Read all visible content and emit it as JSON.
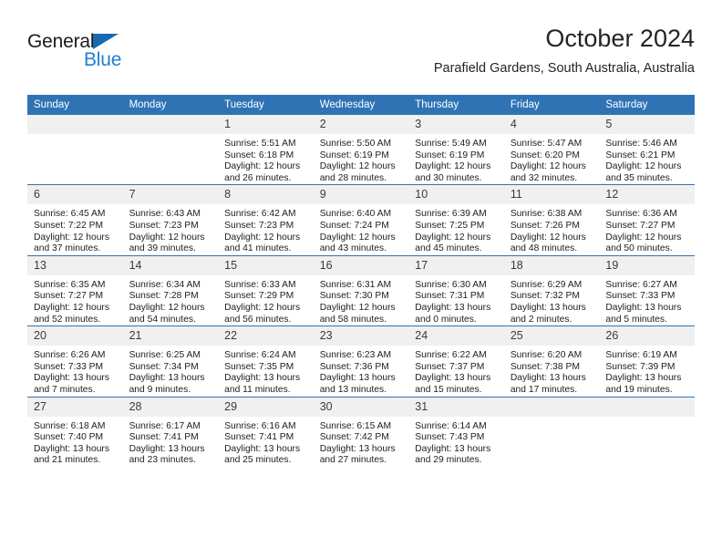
{
  "branding": {
    "logo_primary": "General",
    "logo_secondary": "Blue",
    "logo_primary_color": "#1b1b1b",
    "logo_secondary_color": "#1f7fd0",
    "triangle_icon": "blue-triangle-icon"
  },
  "header": {
    "title": "October 2024",
    "subtitle": "Parafield Gardens, South Australia, Australia"
  },
  "theme": {
    "header_blue": "#2f73b5",
    "daynum_band": "#f0f0f0",
    "text": "#1d1d1d"
  },
  "calendar": {
    "weekday_headers": [
      "Sunday",
      "Monday",
      "Tuesday",
      "Wednesday",
      "Thursday",
      "Friday",
      "Saturday"
    ],
    "weeks": [
      [
        {
          "day": "",
          "empty": true,
          "sunrise": "",
          "sunset": "",
          "daylight_line1": "",
          "daylight_line2": ""
        },
        {
          "day": "",
          "empty": true,
          "sunrise": "",
          "sunset": "",
          "daylight_line1": "",
          "daylight_line2": ""
        },
        {
          "day": "1",
          "sunrise": "Sunrise: 5:51 AM",
          "sunset": "Sunset: 6:18 PM",
          "daylight_line1": "Daylight: 12 hours",
          "daylight_line2": "and 26 minutes."
        },
        {
          "day": "2",
          "sunrise": "Sunrise: 5:50 AM",
          "sunset": "Sunset: 6:19 PM",
          "daylight_line1": "Daylight: 12 hours",
          "daylight_line2": "and 28 minutes."
        },
        {
          "day": "3",
          "sunrise": "Sunrise: 5:49 AM",
          "sunset": "Sunset: 6:19 PM",
          "daylight_line1": "Daylight: 12 hours",
          "daylight_line2": "and 30 minutes."
        },
        {
          "day": "4",
          "sunrise": "Sunrise: 5:47 AM",
          "sunset": "Sunset: 6:20 PM",
          "daylight_line1": "Daylight: 12 hours",
          "daylight_line2": "and 32 minutes."
        },
        {
          "day": "5",
          "sunrise": "Sunrise: 5:46 AM",
          "sunset": "Sunset: 6:21 PM",
          "daylight_line1": "Daylight: 12 hours",
          "daylight_line2": "and 35 minutes."
        }
      ],
      [
        {
          "day": "6",
          "sunrise": "Sunrise: 6:45 AM",
          "sunset": "Sunset: 7:22 PM",
          "daylight_line1": "Daylight: 12 hours",
          "daylight_line2": "and 37 minutes."
        },
        {
          "day": "7",
          "sunrise": "Sunrise: 6:43 AM",
          "sunset": "Sunset: 7:23 PM",
          "daylight_line1": "Daylight: 12 hours",
          "daylight_line2": "and 39 minutes."
        },
        {
          "day": "8",
          "sunrise": "Sunrise: 6:42 AM",
          "sunset": "Sunset: 7:23 PM",
          "daylight_line1": "Daylight: 12 hours",
          "daylight_line2": "and 41 minutes."
        },
        {
          "day": "9",
          "sunrise": "Sunrise: 6:40 AM",
          "sunset": "Sunset: 7:24 PM",
          "daylight_line1": "Daylight: 12 hours",
          "daylight_line2": "and 43 minutes."
        },
        {
          "day": "10",
          "sunrise": "Sunrise: 6:39 AM",
          "sunset": "Sunset: 7:25 PM",
          "daylight_line1": "Daylight: 12 hours",
          "daylight_line2": "and 45 minutes."
        },
        {
          "day": "11",
          "sunrise": "Sunrise: 6:38 AM",
          "sunset": "Sunset: 7:26 PM",
          "daylight_line1": "Daylight: 12 hours",
          "daylight_line2": "and 48 minutes."
        },
        {
          "day": "12",
          "sunrise": "Sunrise: 6:36 AM",
          "sunset": "Sunset: 7:27 PM",
          "daylight_line1": "Daylight: 12 hours",
          "daylight_line2": "and 50 minutes."
        }
      ],
      [
        {
          "day": "13",
          "sunrise": "Sunrise: 6:35 AM",
          "sunset": "Sunset: 7:27 PM",
          "daylight_line1": "Daylight: 12 hours",
          "daylight_line2": "and 52 minutes."
        },
        {
          "day": "14",
          "sunrise": "Sunrise: 6:34 AM",
          "sunset": "Sunset: 7:28 PM",
          "daylight_line1": "Daylight: 12 hours",
          "daylight_line2": "and 54 minutes."
        },
        {
          "day": "15",
          "sunrise": "Sunrise: 6:33 AM",
          "sunset": "Sunset: 7:29 PM",
          "daylight_line1": "Daylight: 12 hours",
          "daylight_line2": "and 56 minutes."
        },
        {
          "day": "16",
          "sunrise": "Sunrise: 6:31 AM",
          "sunset": "Sunset: 7:30 PM",
          "daylight_line1": "Daylight: 12 hours",
          "daylight_line2": "and 58 minutes."
        },
        {
          "day": "17",
          "sunrise": "Sunrise: 6:30 AM",
          "sunset": "Sunset: 7:31 PM",
          "daylight_line1": "Daylight: 13 hours",
          "daylight_line2": "and 0 minutes."
        },
        {
          "day": "18",
          "sunrise": "Sunrise: 6:29 AM",
          "sunset": "Sunset: 7:32 PM",
          "daylight_line1": "Daylight: 13 hours",
          "daylight_line2": "and 2 minutes."
        },
        {
          "day": "19",
          "sunrise": "Sunrise: 6:27 AM",
          "sunset": "Sunset: 7:33 PM",
          "daylight_line1": "Daylight: 13 hours",
          "daylight_line2": "and 5 minutes."
        }
      ],
      [
        {
          "day": "20",
          "sunrise": "Sunrise: 6:26 AM",
          "sunset": "Sunset: 7:33 PM",
          "daylight_line1": "Daylight: 13 hours",
          "daylight_line2": "and 7 minutes."
        },
        {
          "day": "21",
          "sunrise": "Sunrise: 6:25 AM",
          "sunset": "Sunset: 7:34 PM",
          "daylight_line1": "Daylight: 13 hours",
          "daylight_line2": "and 9 minutes."
        },
        {
          "day": "22",
          "sunrise": "Sunrise: 6:24 AM",
          "sunset": "Sunset: 7:35 PM",
          "daylight_line1": "Daylight: 13 hours",
          "daylight_line2": "and 11 minutes."
        },
        {
          "day": "23",
          "sunrise": "Sunrise: 6:23 AM",
          "sunset": "Sunset: 7:36 PM",
          "daylight_line1": "Daylight: 13 hours",
          "daylight_line2": "and 13 minutes."
        },
        {
          "day": "24",
          "sunrise": "Sunrise: 6:22 AM",
          "sunset": "Sunset: 7:37 PM",
          "daylight_line1": "Daylight: 13 hours",
          "daylight_line2": "and 15 minutes."
        },
        {
          "day": "25",
          "sunrise": "Sunrise: 6:20 AM",
          "sunset": "Sunset: 7:38 PM",
          "daylight_line1": "Daylight: 13 hours",
          "daylight_line2": "and 17 minutes."
        },
        {
          "day": "26",
          "sunrise": "Sunrise: 6:19 AM",
          "sunset": "Sunset: 7:39 PM",
          "daylight_line1": "Daylight: 13 hours",
          "daylight_line2": "and 19 minutes."
        }
      ],
      [
        {
          "day": "27",
          "sunrise": "Sunrise: 6:18 AM",
          "sunset": "Sunset: 7:40 PM",
          "daylight_line1": "Daylight: 13 hours",
          "daylight_line2": "and 21 minutes."
        },
        {
          "day": "28",
          "sunrise": "Sunrise: 6:17 AM",
          "sunset": "Sunset: 7:41 PM",
          "daylight_line1": "Daylight: 13 hours",
          "daylight_line2": "and 23 minutes."
        },
        {
          "day": "29",
          "sunrise": "Sunrise: 6:16 AM",
          "sunset": "Sunset: 7:41 PM",
          "daylight_line1": "Daylight: 13 hours",
          "daylight_line2": "and 25 minutes."
        },
        {
          "day": "30",
          "sunrise": "Sunrise: 6:15 AM",
          "sunset": "Sunset: 7:42 PM",
          "daylight_line1": "Daylight: 13 hours",
          "daylight_line2": "and 27 minutes."
        },
        {
          "day": "31",
          "sunrise": "Sunrise: 6:14 AM",
          "sunset": "Sunset: 7:43 PM",
          "daylight_line1": "Daylight: 13 hours",
          "daylight_line2": "and 29 minutes."
        },
        {
          "day": "",
          "empty": true,
          "sunrise": "",
          "sunset": "",
          "daylight_line1": "",
          "daylight_line2": ""
        },
        {
          "day": "",
          "empty": true,
          "sunrise": "",
          "sunset": "",
          "daylight_line1": "",
          "daylight_line2": ""
        }
      ]
    ]
  }
}
